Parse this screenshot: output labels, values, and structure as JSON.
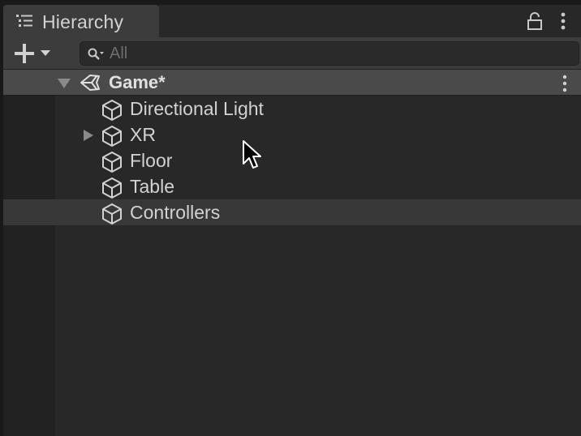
{
  "window": {
    "tab_label": "Hierarchy",
    "tab_icon": "list-icon",
    "lock_icon": "lock-icon",
    "menu_icon": "kebab-menu-icon"
  },
  "toolbar": {
    "add_icon": "plus-icon",
    "dropdown_icon": "caret-down-icon",
    "search": {
      "placeholder": "All",
      "value": "",
      "icon": "search-icon"
    }
  },
  "scene": {
    "name": "Game*",
    "expanded": true,
    "icon": "unity-logo-icon",
    "menu_icon": "kebab-menu-icon"
  },
  "objects": [
    {
      "label": "Directional Light",
      "has_children": false,
      "icon": "gameobject-cube-icon"
    },
    {
      "label": "XR",
      "has_children": true,
      "expanded": false,
      "icon": "gameobject-cube-icon"
    },
    {
      "label": "Floor",
      "has_children": false,
      "icon": "gameobject-cube-icon"
    },
    {
      "label": "Table",
      "has_children": false,
      "icon": "gameobject-cube-icon"
    },
    {
      "label": "Controllers",
      "has_children": false,
      "icon": "gameobject-cube-icon",
      "hovered": true
    }
  ],
  "colors": {
    "background": "#282828",
    "toolbar": "#3c3c3c",
    "scene_header": "#4a4a4a",
    "hover_row": "#383838",
    "text": "#d2d2d2"
  }
}
